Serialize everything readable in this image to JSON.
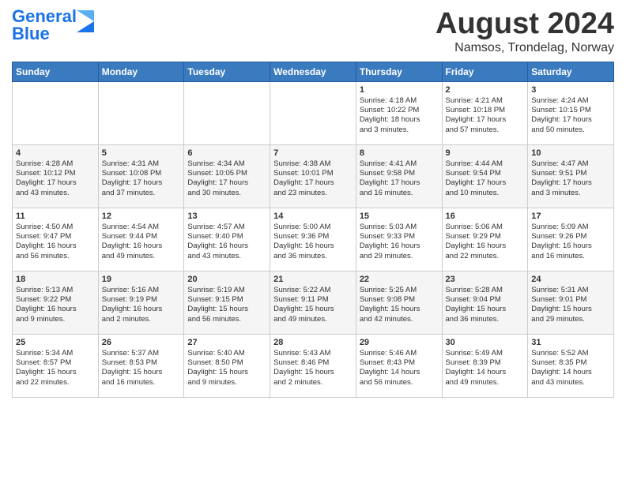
{
  "header": {
    "logo_line1": "General",
    "logo_line2": "Blue",
    "main_title": "August 2024",
    "subtitle": "Namsos, Trondelag, Norway"
  },
  "weekdays": [
    "Sunday",
    "Monday",
    "Tuesday",
    "Wednesday",
    "Thursday",
    "Friday",
    "Saturday"
  ],
  "weeks": [
    [
      {
        "num": "",
        "info": ""
      },
      {
        "num": "",
        "info": ""
      },
      {
        "num": "",
        "info": ""
      },
      {
        "num": "",
        "info": ""
      },
      {
        "num": "1",
        "info": "Sunrise: 4:18 AM\nSunset: 10:22 PM\nDaylight: 18 hours\nand 3 minutes."
      },
      {
        "num": "2",
        "info": "Sunrise: 4:21 AM\nSunset: 10:18 PM\nDaylight: 17 hours\nand 57 minutes."
      },
      {
        "num": "3",
        "info": "Sunrise: 4:24 AM\nSunset: 10:15 PM\nDaylight: 17 hours\nand 50 minutes."
      }
    ],
    [
      {
        "num": "4",
        "info": "Sunrise: 4:28 AM\nSunset: 10:12 PM\nDaylight: 17 hours\nand 43 minutes."
      },
      {
        "num": "5",
        "info": "Sunrise: 4:31 AM\nSunset: 10:08 PM\nDaylight: 17 hours\nand 37 minutes."
      },
      {
        "num": "6",
        "info": "Sunrise: 4:34 AM\nSunset: 10:05 PM\nDaylight: 17 hours\nand 30 minutes."
      },
      {
        "num": "7",
        "info": "Sunrise: 4:38 AM\nSunset: 10:01 PM\nDaylight: 17 hours\nand 23 minutes."
      },
      {
        "num": "8",
        "info": "Sunrise: 4:41 AM\nSunset: 9:58 PM\nDaylight: 17 hours\nand 16 minutes."
      },
      {
        "num": "9",
        "info": "Sunrise: 4:44 AM\nSunset: 9:54 PM\nDaylight: 17 hours\nand 10 minutes."
      },
      {
        "num": "10",
        "info": "Sunrise: 4:47 AM\nSunset: 9:51 PM\nDaylight: 17 hours\nand 3 minutes."
      }
    ],
    [
      {
        "num": "11",
        "info": "Sunrise: 4:50 AM\nSunset: 9:47 PM\nDaylight: 16 hours\nand 56 minutes."
      },
      {
        "num": "12",
        "info": "Sunrise: 4:54 AM\nSunset: 9:44 PM\nDaylight: 16 hours\nand 49 minutes."
      },
      {
        "num": "13",
        "info": "Sunrise: 4:57 AM\nSunset: 9:40 PM\nDaylight: 16 hours\nand 43 minutes."
      },
      {
        "num": "14",
        "info": "Sunrise: 5:00 AM\nSunset: 9:36 PM\nDaylight: 16 hours\nand 36 minutes."
      },
      {
        "num": "15",
        "info": "Sunrise: 5:03 AM\nSunset: 9:33 PM\nDaylight: 16 hours\nand 29 minutes."
      },
      {
        "num": "16",
        "info": "Sunrise: 5:06 AM\nSunset: 9:29 PM\nDaylight: 16 hours\nand 22 minutes."
      },
      {
        "num": "17",
        "info": "Sunrise: 5:09 AM\nSunset: 9:26 PM\nDaylight: 16 hours\nand 16 minutes."
      }
    ],
    [
      {
        "num": "18",
        "info": "Sunrise: 5:13 AM\nSunset: 9:22 PM\nDaylight: 16 hours\nand 9 minutes."
      },
      {
        "num": "19",
        "info": "Sunrise: 5:16 AM\nSunset: 9:19 PM\nDaylight: 16 hours\nand 2 minutes."
      },
      {
        "num": "20",
        "info": "Sunrise: 5:19 AM\nSunset: 9:15 PM\nDaylight: 15 hours\nand 56 minutes."
      },
      {
        "num": "21",
        "info": "Sunrise: 5:22 AM\nSunset: 9:11 PM\nDaylight: 15 hours\nand 49 minutes."
      },
      {
        "num": "22",
        "info": "Sunrise: 5:25 AM\nSunset: 9:08 PM\nDaylight: 15 hours\nand 42 minutes."
      },
      {
        "num": "23",
        "info": "Sunrise: 5:28 AM\nSunset: 9:04 PM\nDaylight: 15 hours\nand 36 minutes."
      },
      {
        "num": "24",
        "info": "Sunrise: 5:31 AM\nSunset: 9:01 PM\nDaylight: 15 hours\nand 29 minutes."
      }
    ],
    [
      {
        "num": "25",
        "info": "Sunrise: 5:34 AM\nSunset: 8:57 PM\nDaylight: 15 hours\nand 22 minutes."
      },
      {
        "num": "26",
        "info": "Sunrise: 5:37 AM\nSunset: 8:53 PM\nDaylight: 15 hours\nand 16 minutes."
      },
      {
        "num": "27",
        "info": "Sunrise: 5:40 AM\nSunset: 8:50 PM\nDaylight: 15 hours\nand 9 minutes."
      },
      {
        "num": "28",
        "info": "Sunrise: 5:43 AM\nSunset: 8:46 PM\nDaylight: 15 hours\nand 2 minutes."
      },
      {
        "num": "29",
        "info": "Sunrise: 5:46 AM\nSunset: 8:43 PM\nDaylight: 14 hours\nand 56 minutes."
      },
      {
        "num": "30",
        "info": "Sunrise: 5:49 AM\nSunset: 8:39 PM\nDaylight: 14 hours\nand 49 minutes."
      },
      {
        "num": "31",
        "info": "Sunrise: 5:52 AM\nSunset: 8:35 PM\nDaylight: 14 hours\nand 43 minutes."
      }
    ]
  ]
}
